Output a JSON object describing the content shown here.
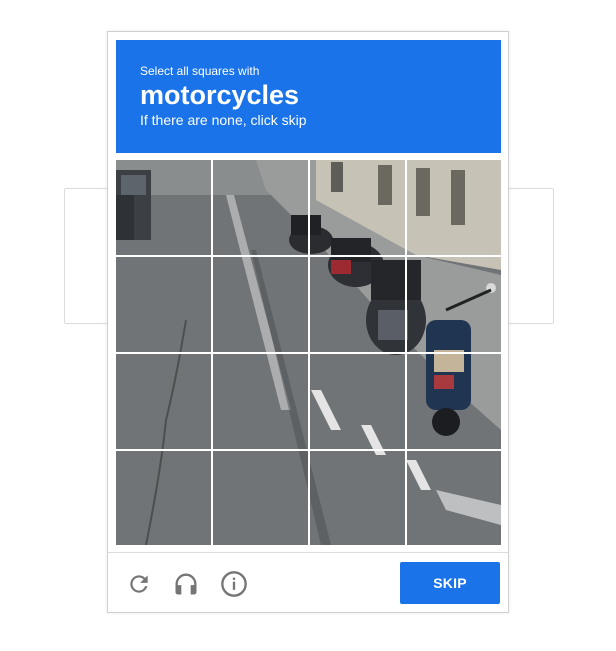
{
  "challenge": {
    "instruction_prefix": "Select all squares with",
    "target_object": "motorcycles",
    "instruction_suffix": "If there are none, click skip"
  },
  "grid": {
    "rows": 4,
    "cols": 4,
    "image_description_icon": "street-scene-with-motorcycles"
  },
  "footer": {
    "reload_icon": "reload-icon",
    "audio_icon": "headphones-icon",
    "info_icon": "info-icon",
    "skip_label": "SKIP"
  },
  "colors": {
    "accent": "#1a73e8",
    "icon_gray": "#757575"
  }
}
